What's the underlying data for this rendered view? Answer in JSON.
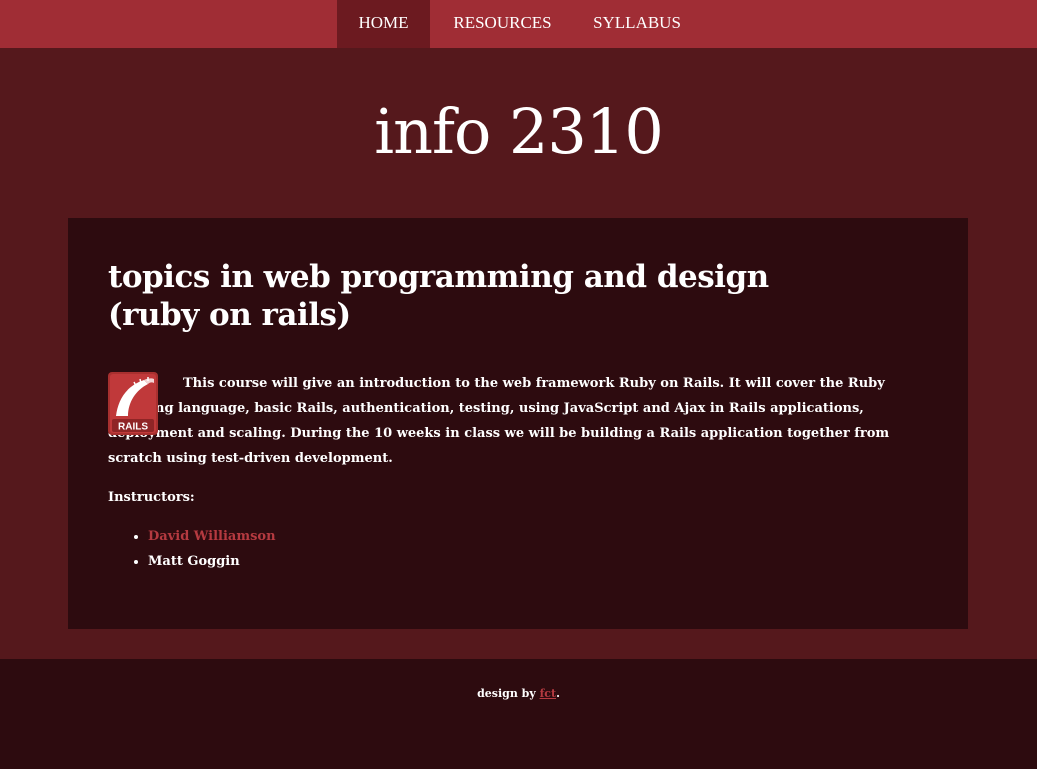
{
  "nav": {
    "items": [
      {
        "label": "HOME",
        "active": true
      },
      {
        "label": "RESOURCES",
        "active": false
      },
      {
        "label": "SYLLABUS",
        "active": false
      }
    ]
  },
  "site_title": "info 2310",
  "main": {
    "heading_line1": "topics in web programming and design",
    "heading_line2": "(ruby on rails)",
    "logo_icon": "rails-logo",
    "logo_text": "RAILS",
    "intro": "This course will give an introduction to the web framework Ruby on Rails. It will cover the Ruby scripting language, basic Rails, authentication, testing, using JavaScript and Ajax in Rails applications, deployment and scaling. During the 10 weeks in class we will be building a Rails application together from scratch using test-driven development.",
    "instructors_label": "Instructors:",
    "instructors": [
      {
        "name": "David Williamson",
        "is_link": true
      },
      {
        "name": "Matt Goggin",
        "is_link": false
      }
    ]
  },
  "footer": {
    "prefix": "design by ",
    "link_label": "fct",
    "suffix": "."
  },
  "colors": {
    "nav_bar": "#a02d35",
    "nav_active": "#6c1a20",
    "page_bg": "#55181c",
    "panel_bg": "#2d0b0f",
    "link": "#b53a40"
  }
}
